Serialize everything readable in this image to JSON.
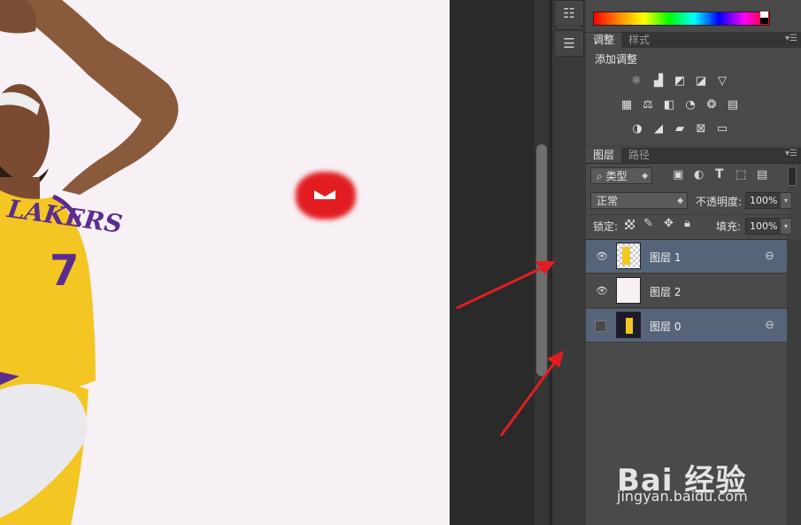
{
  "canvas": {
    "player_number": "7",
    "jersey_text": "LAKERS",
    "background_color": "#f7f0f4"
  },
  "adjustments": {
    "tabs": [
      "调整",
      "样式"
    ],
    "title": "添加调整",
    "icons_row1": [
      "brightness-icon",
      "levels-icon",
      "curves-icon",
      "exposure-icon",
      "vibrance-icon"
    ],
    "icons_row2": [
      "hue-saturation-icon",
      "color-balance-icon",
      "black-white-icon",
      "photo-filter-icon",
      "channel-mixer-icon",
      "color-lookup-icon"
    ],
    "icons_row3": [
      "invert-icon",
      "posterize-icon",
      "threshold-icon",
      "selective-color-icon",
      "gradient-map-icon"
    ]
  },
  "layers_panel": {
    "tabs": [
      "图层",
      "路径"
    ],
    "filter_label": "类型",
    "blend_mode": "正常",
    "opacity_label": "不透明度:",
    "opacity_value": "100%",
    "lock_label": "锁定:",
    "fill_label": "填充:",
    "fill_value": "100%",
    "layers": [
      {
        "name": "图层 1",
        "visible": true,
        "selected": true,
        "linked": true
      },
      {
        "name": "图层 2",
        "visible": true,
        "selected": false,
        "linked": false
      },
      {
        "name": "图层 0",
        "visible": false,
        "selected": true,
        "linked": true
      }
    ]
  },
  "watermark": {
    "brand": "Bai 经验",
    "url": "jingyan.baidu.com"
  },
  "colors": {
    "selected_layer": "#56647a",
    "annotation_red": "#e21d22",
    "jersey_yellow": "#f3c623"
  }
}
